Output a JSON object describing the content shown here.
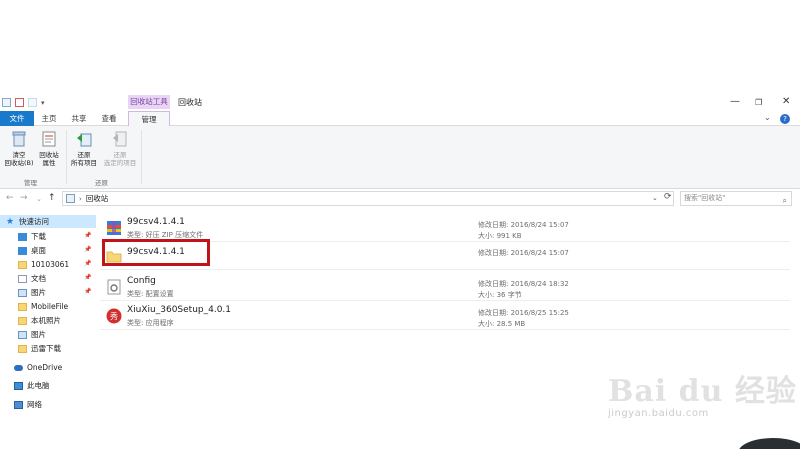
{
  "window": {
    "title": "回收站",
    "context_tab": "回收站工具"
  },
  "ribbon_tabs": [
    "文件",
    "主页",
    "共享",
    "查看",
    "管理"
  ],
  "ribbon": {
    "empty_bin": "清空\n回收站(B)",
    "bin_props": "回收站\n属性",
    "restore_all": "还原\n所有项目",
    "restore_selected": "还原\n选定的项目",
    "group_manage": "管理",
    "group_restore": "还原"
  },
  "address": {
    "path": "回收站",
    "search_placeholder": "搜索\"回收站\""
  },
  "sidebar": [
    {
      "label": "快速访问",
      "icon": "star-icon",
      "pinned": false
    },
    {
      "label": "下载",
      "icon": "download-icon",
      "pinned": true
    },
    {
      "label": "桌面",
      "icon": "desktop-icon",
      "pinned": true
    },
    {
      "label": "10103061",
      "icon": "folder-icon",
      "pinned": true
    },
    {
      "label": "文档",
      "icon": "document-icon",
      "pinned": true
    },
    {
      "label": "图片",
      "icon": "picture-icon",
      "pinned": true
    },
    {
      "label": "MobileFile",
      "icon": "folder-icon",
      "pinned": false
    },
    {
      "label": "本机照片",
      "icon": "folder-icon",
      "pinned": false
    },
    {
      "label": "图片",
      "icon": "picture-icon",
      "pinned": false
    },
    {
      "label": "迅雷下载",
      "icon": "folder-icon",
      "pinned": false
    },
    {
      "label": "OneDrive",
      "icon": "cloud-icon",
      "pinned": false
    },
    {
      "label": "此电脑",
      "icon": "computer-icon",
      "pinned": false
    },
    {
      "label": "网络",
      "icon": "network-icon",
      "pinned": false
    }
  ],
  "files": [
    {
      "name": "99csv4.1.4.1",
      "type": "类型: 好压 ZIP 压缩文件",
      "modified": "修改日期: 2016/8/24 15:07",
      "size": "大小: 991 KB",
      "icon": "zip-archive-icon"
    },
    {
      "name": "99csv4.1.4.1",
      "type": "",
      "modified": "修改日期: 2016/8/24 15:07",
      "size": "",
      "icon": "folder-icon"
    },
    {
      "name": "Config",
      "type": "类型: 配置设置",
      "modified": "修改日期: 2016/8/24 18:32",
      "size": "大小: 36 字节",
      "icon": "config-file-icon"
    },
    {
      "name": "XiuXiu_360Setup_4.0.1",
      "type": "类型: 应用程序",
      "modified": "修改日期: 2016/8/25 15:25",
      "size": "大小: 28.5 MB",
      "icon": "app-icon"
    }
  ],
  "watermark": {
    "logo": "Bai du 经验",
    "url": "jingyan.baidu.com"
  },
  "colors": {
    "file_tab": "#1979ca",
    "context_tab": "#e8d5f5",
    "highlight": "#c0141a",
    "sidebar_selected": "#cce8ff"
  }
}
